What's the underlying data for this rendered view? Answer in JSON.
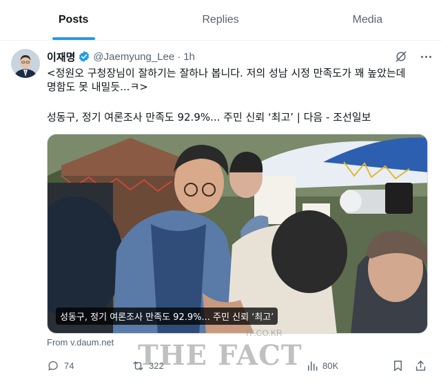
{
  "tabs": [
    {
      "label": "Posts",
      "active": true
    },
    {
      "label": "Replies",
      "active": false
    },
    {
      "label": "Media",
      "active": false
    }
  ],
  "post": {
    "author_name": "이재명",
    "handle": "@Jaemyung_Lee",
    "separator": "·",
    "time": "1h",
    "verified_icon": "verified-badge-icon",
    "text": "<정원오 구청장님이 잘하기는 잘하나 봅니다. 저의 성남 시정 만족도가 꽤 높았는데\n명함도 못 내밀듯...ㅋ>",
    "link_title": "성동구, 정기 여론조사 만족도 92.9%... 주민 신뢰 ‘최고’ | 다음 - 조선일보",
    "media_caption": "성동구, 정기 여론조사 만족도 92.9%... 주민 신뢰 ‘최고’",
    "source": "From v.daum.net"
  },
  "actions": {
    "replies": "74",
    "reposts": "322",
    "views": "80K"
  },
  "watermark": {
    "main": "THE FACT",
    "small": "TF.CO.KR"
  },
  "colors": {
    "accent": "#1d9bf0",
    "secondary_text": "#536471",
    "primary_text": "#0f1419"
  }
}
